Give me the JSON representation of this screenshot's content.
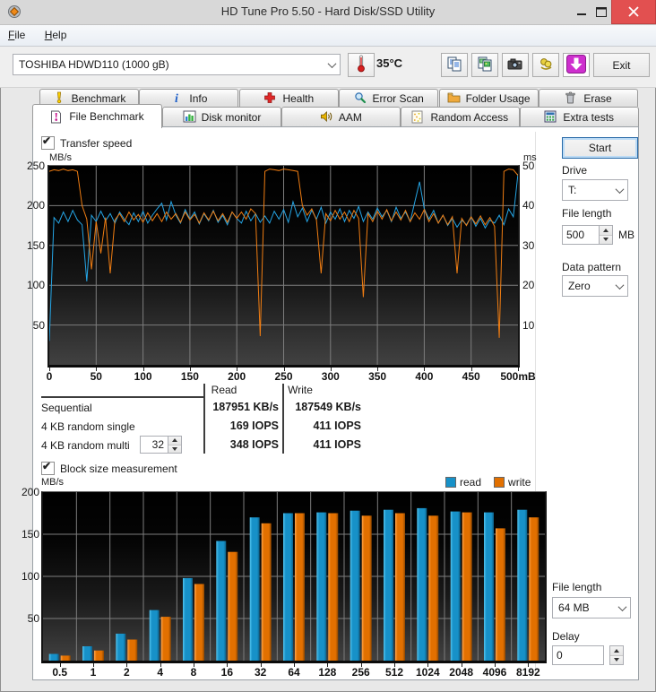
{
  "window": {
    "title": "HD Tune Pro 5.50 - Hard Disk/SSD Utility"
  },
  "menu": {
    "items": [
      "File",
      "Help"
    ]
  },
  "toolbar": {
    "drive_select": "TOSHIBA HDWD110 (1000 gB)",
    "temperature": "35°C",
    "exit_label": "Exit",
    "icons": [
      "thermometer-icon",
      "copy-report-icon",
      "copy-image-icon",
      "screenshot-icon",
      "donate-icon",
      "update-icon"
    ]
  },
  "tabs": {
    "row1": [
      {
        "label": "Benchmark",
        "icon": "benchmark-icon"
      },
      {
        "label": "Info",
        "icon": "info-icon"
      },
      {
        "label": "Health",
        "icon": "health-icon"
      },
      {
        "label": "Error Scan",
        "icon": "error-scan-icon"
      },
      {
        "label": "Folder Usage",
        "icon": "folder-usage-icon"
      },
      {
        "label": "Erase",
        "icon": "erase-icon"
      }
    ],
    "row2": [
      {
        "label": "File Benchmark",
        "icon": "file-benchmark-icon",
        "active": true
      },
      {
        "label": "Disk monitor",
        "icon": "disk-monitor-icon"
      },
      {
        "label": "AAM",
        "icon": "aam-icon"
      },
      {
        "label": "Random Access",
        "icon": "random-access-icon"
      },
      {
        "label": "Extra tests",
        "icon": "extra-tests-icon"
      }
    ]
  },
  "transfer": {
    "checkbox_label": "Transfer speed",
    "start_label": "Start",
    "drive_label": "Drive",
    "drive_value": "T:",
    "file_length_label": "File length",
    "file_length_value": "500",
    "file_length_unit": "MB",
    "data_pattern_label": "Data pattern",
    "data_pattern_value": "Zero"
  },
  "results": {
    "headers": [
      "Read",
      "Write"
    ],
    "rows": [
      {
        "label": "Sequential",
        "read": "187951 KB/s",
        "write": "187549 KB/s"
      },
      {
        "label": "4 KB random single",
        "read": "169 IOPS",
        "write": "411 IOPS"
      },
      {
        "label": "4 KB random multi",
        "spinner": "32",
        "read": "348 IOPS",
        "write": "411 IOPS"
      }
    ]
  },
  "block": {
    "checkbox_label": "Block size measurement",
    "file_length_label": "File length",
    "file_length_value": "64 MB",
    "delay_label": "Delay",
    "delay_value": "0"
  },
  "chart_data": [
    {
      "type": "line",
      "title": "Transfer speed",
      "ylabel_left": "MB/s",
      "ylabel_right": "ms",
      "ylim_left": [
        0,
        250
      ],
      "ylim_right": [
        0,
        50
      ],
      "xlim": [
        0,
        500
      ],
      "grid": true,
      "left_ticks": [
        250,
        200,
        150,
        100,
        50
      ],
      "right_ticks": [
        50,
        40,
        30,
        20,
        10
      ],
      "x_ticks": [
        "0",
        "50",
        "100",
        "150",
        "200",
        "250",
        "300",
        "350",
        "400",
        "450",
        "500mB"
      ],
      "x_tick_values": [
        0,
        50,
        100,
        150,
        200,
        250,
        300,
        350,
        400,
        450,
        500
      ],
      "series": [
        {
          "name": "read",
          "color": "#25A5E5",
          "x_step": 5,
          "y": [
            30,
            185,
            178,
            192,
            180,
            194,
            182,
            176,
            105,
            188,
            180,
            193,
            181,
            190,
            178,
            192,
            183,
            176,
            191,
            180,
            193,
            178,
            188,
            196,
            203,
            182,
            205,
            188,
            178,
            195,
            183,
            192,
            177,
            190,
            181,
            194,
            179,
            188,
            176,
            192,
            184,
            178,
            193,
            181,
            190,
            179,
            187,
            178,
            193,
            183,
            195,
            179,
            205,
            186,
            197,
            180,
            194,
            183,
            198,
            178,
            192,
            183,
            196,
            180,
            194,
            184,
            199,
            180,
            192,
            183,
            197,
            186,
            194,
            180,
            198,
            184,
            192,
            180,
            205,
            230,
            196,
            183,
            194,
            178,
            188,
            175,
            184,
            173,
            182,
            176,
            186,
            174,
            184,
            172,
            182,
            178,
            188,
            176,
            196,
            186,
            240
          ]
        },
        {
          "name": "write",
          "color": "#F07D12",
          "x_step": 5,
          "y": [
            243,
            245,
            244,
            246,
            244,
            245,
            243,
            200,
            183,
            120,
            180,
            140,
            185,
            115,
            182,
            190,
            180,
            192,
            182,
            189,
            179,
            191,
            181,
            190,
            180,
            192,
            183,
            190,
            179,
            192,
            182,
            189,
            178,
            191,
            182,
            193,
            181,
            190,
            179,
            192,
            184,
            192,
            183,
            196,
            190,
            36,
            243,
            246,
            245,
            244,
            246,
            245,
            244,
            243,
            200,
            188,
            196,
            182,
            115,
            190,
            181,
            194,
            183,
            192,
            180,
            194,
            184,
            85,
            190,
            180,
            193,
            183,
            195,
            181,
            192,
            182,
            194,
            180,
            191,
            183,
            195,
            180,
            190,
            178,
            188,
            176,
            186,
            115,
            184,
            175,
            186,
            177,
            187,
            176,
            185,
            174,
            34,
            243,
            246,
            245,
            238
          ]
        }
      ]
    },
    {
      "type": "bar",
      "title": "Block size measurement",
      "ylabel": "MB/s",
      "ylim": [
        0,
        200
      ],
      "grid": true,
      "legend_position": "top-right",
      "y_ticks": [
        200,
        150,
        100,
        50
      ],
      "categories": [
        "0.5",
        "1",
        "2",
        "4",
        "8",
        "16",
        "32",
        "64",
        "128",
        "256",
        "512",
        "1024",
        "2048",
        "4096",
        "8192"
      ],
      "series": [
        {
          "name": "read",
          "color": "#1791C8",
          "light": "#54C5F0",
          "dark": "#0C5E86",
          "values": [
            8,
            17,
            32,
            60,
            98,
            142,
            170,
            175,
            176,
            178,
            179,
            181,
            177,
            176,
            179
          ]
        },
        {
          "name": "write",
          "color": "#E27000",
          "light": "#FFA348",
          "dark": "#8F4700",
          "values": [
            6,
            12,
            25,
            52,
            91,
            129,
            163,
            175,
            175,
            172,
            175,
            172,
            176,
            157,
            170
          ]
        }
      ]
    }
  ]
}
